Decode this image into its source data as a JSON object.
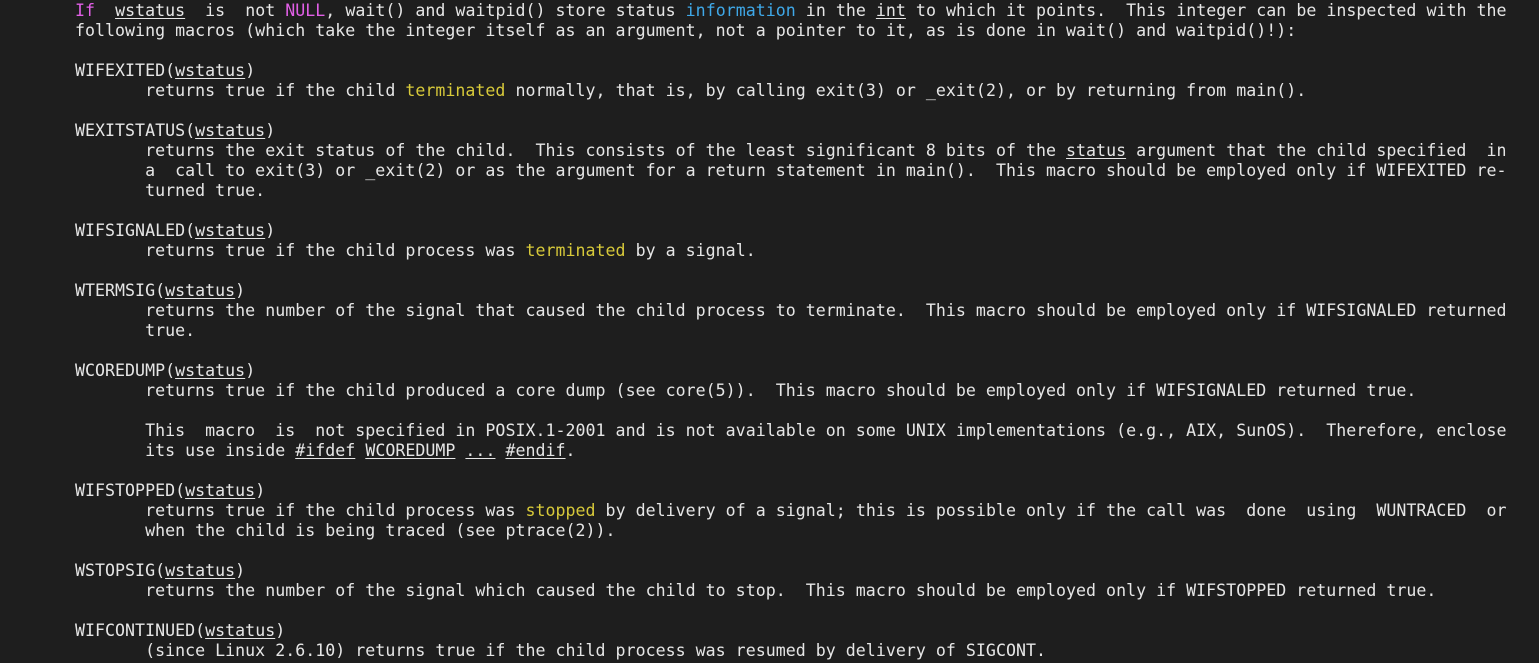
{
  "lines": [
    [
      {
        "t": "If",
        "c": "#e15fe6"
      },
      {
        "t": "  "
      },
      {
        "t": "wstatus",
        "u": true
      },
      {
        "t": "  is  not "
      },
      {
        "t": "NULL",
        "c": "#e15fe6"
      },
      {
        "t": ", wait() and waitpid() store status "
      },
      {
        "t": "information",
        "c": "#3fa8e8"
      },
      {
        "t": " in the "
      },
      {
        "t": "int",
        "u": true
      },
      {
        "t": " to which it points.  This integer can be inspected with the"
      }
    ],
    [
      {
        "t": "following macros (which take the integer itself as an argument, not a pointer to it, as is done in wait() and waitpid()!):"
      }
    ],
    [],
    [
      {
        "t": "WIFEXITED("
      },
      {
        "t": "wstatus",
        "u": true
      },
      {
        "t": ")"
      }
    ],
    [
      {
        "t": "       returns true if the child "
      },
      {
        "t": "terminated",
        "c": "#d7c93a"
      },
      {
        "t": " normally, that is, by calling exit(3) or _exit(2), or by returning from main()."
      }
    ],
    [],
    [
      {
        "t": "WEXITSTATUS("
      },
      {
        "t": "wstatus",
        "u": true
      },
      {
        "t": ")"
      }
    ],
    [
      {
        "t": "       returns the exit status of the child.  This consists of the least significant 8 bits of the "
      },
      {
        "t": "status",
        "u": true
      },
      {
        "t": " argument that the child specified  in"
      }
    ],
    [
      {
        "t": "       a  call to exit(3) or _exit(2) or as the argument for a return statement in main().  This macro should be employed only if WIFEXITED re-"
      }
    ],
    [
      {
        "t": "       turned true."
      }
    ],
    [],
    [
      {
        "t": "WIFSIGNALED("
      },
      {
        "t": "wstatus",
        "u": true
      },
      {
        "t": ")"
      }
    ],
    [
      {
        "t": "       returns true if the child process was "
      },
      {
        "t": "terminated",
        "c": "#d7c93a"
      },
      {
        "t": " by a signal."
      }
    ],
    [],
    [
      {
        "t": "WTERMSIG("
      },
      {
        "t": "wstatus",
        "u": true
      },
      {
        "t": ")"
      }
    ],
    [
      {
        "t": "       returns the number of the signal that caused the child process to terminate.  This macro should be employed only if WIFSIGNALED returned"
      }
    ],
    [
      {
        "t": "       true."
      }
    ],
    [],
    [
      {
        "t": "WCOREDUMP("
      },
      {
        "t": "wstatus",
        "u": true
      },
      {
        "t": ")"
      }
    ],
    [
      {
        "t": "       returns true if the child produced a core dump (see core(5)).  This macro should be employed only if WIFSIGNALED returned true."
      }
    ],
    [],
    [
      {
        "t": "       This  macro  is  not specified in POSIX.1-2001 and is not available on some UNIX implementations (e.g., AIX, SunOS).  Therefore, enclose"
      }
    ],
    [
      {
        "t": "       its use inside "
      },
      {
        "t": "#ifdef",
        "u": true
      },
      {
        "t": " "
      },
      {
        "t": "WCOREDUMP",
        "u": true
      },
      {
        "t": " "
      },
      {
        "t": "...",
        "u": true
      },
      {
        "t": " "
      },
      {
        "t": "#endif",
        "u": true
      },
      {
        "t": "."
      }
    ],
    [],
    [
      {
        "t": "WIFSTOPPED("
      },
      {
        "t": "wstatus",
        "u": true
      },
      {
        "t": ")"
      }
    ],
    [
      {
        "t": "       returns true if the child process was "
      },
      {
        "t": "stopped",
        "c": "#d7c93a"
      },
      {
        "t": " by delivery of a signal; this is possible only if the call was  done  using  WUNTRACED  or"
      }
    ],
    [
      {
        "t": "       when the child is being traced (see ptrace(2))."
      }
    ],
    [],
    [
      {
        "t": "WSTOPSIG("
      },
      {
        "t": "wstatus",
        "u": true
      },
      {
        "t": ")"
      }
    ],
    [
      {
        "t": "       returns the number of the signal which caused the child to stop.  This macro should be employed only if WIFSTOPPED returned true."
      }
    ],
    [],
    [
      {
        "t": "WIFCONTINUED("
      },
      {
        "t": "wstatus",
        "u": true
      },
      {
        "t": ")"
      }
    ],
    [
      {
        "t": "       (since Linux 2.6.10) returns true if the child process was resumed by delivery of SIGCONT."
      }
    ]
  ],
  "colors": {
    "background": "#1e1e1e",
    "text": "#e6e6e6",
    "keyword": "#e15fe6",
    "info": "#3fa8e8",
    "highlight": "#d7c93a"
  }
}
